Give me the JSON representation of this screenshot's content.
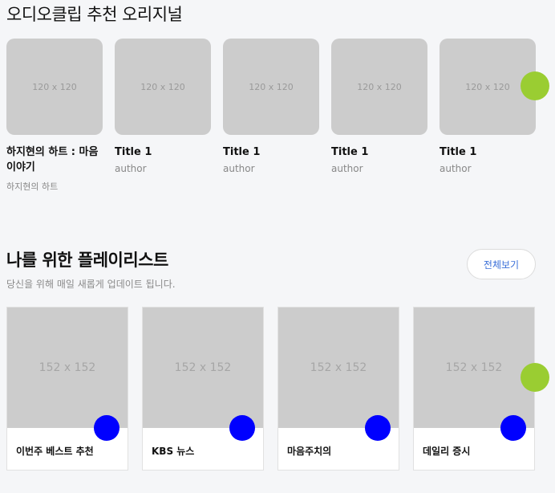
{
  "audio_clips": {
    "title": "오디오클립 추천 오리지널",
    "items": [
      {
        "thumb": "120 x 120",
        "title": "하지현의 하트 : 마음 이야기",
        "author": "하지현의 하트"
      },
      {
        "thumb": "120 x 120",
        "title": "Title 1",
        "author": "author"
      },
      {
        "thumb": "120 x 120",
        "title": "Title 1",
        "author": "author"
      },
      {
        "thumb": "120 x 120",
        "title": "Title 1",
        "author": "author"
      },
      {
        "thumb": "120 x 120",
        "title": "Title 1",
        "author": "author"
      }
    ]
  },
  "playlists": {
    "title": "나를 위한 플레이리스트",
    "subtitle": "당신을 위해 매일 새롭게 업데이트 됩니다.",
    "view_all": "전체보기",
    "items": [
      {
        "thumb": "152 x 152",
        "label": "이번주 베스트 추천"
      },
      {
        "thumb": "152 x 152",
        "label": "KBS 뉴스"
      },
      {
        "thumb": "152 x 152",
        "label": "마음주치의"
      },
      {
        "thumb": "152 x 152",
        "label": "데일리 증시"
      }
    ]
  },
  "colors": {
    "next_button": "#9acd32",
    "play_button": "#0000ff",
    "link": "#3a6fd8"
  }
}
